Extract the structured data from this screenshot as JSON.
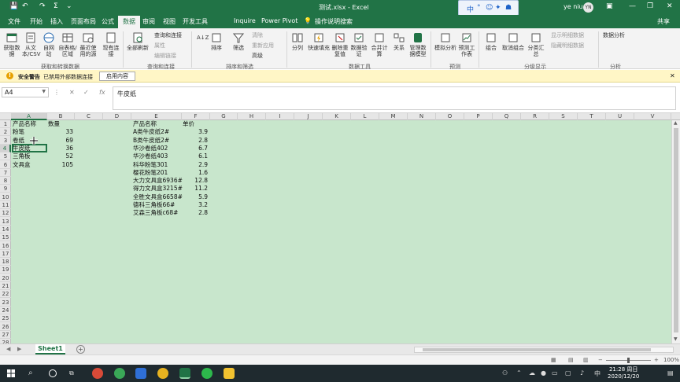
{
  "app": {
    "title": "测试.xlsx - Excel",
    "user": "ye niu",
    "user_initials": "YN",
    "share_label": "共享",
    "brand_color": "#217346"
  },
  "ime": {
    "chars": [
      "中",
      "°",
      "☺",
      "✦",
      "☗"
    ]
  },
  "tabs": [
    {
      "label": "文件"
    },
    {
      "label": "开始"
    },
    {
      "label": "插入"
    },
    {
      "label": "页面布局"
    },
    {
      "label": "公式"
    },
    {
      "label": "数据"
    },
    {
      "label": "审阅"
    },
    {
      "label": "视图"
    },
    {
      "label": "开发工具"
    },
    {
      "label": "Inquire"
    },
    {
      "label": "Power Pivot"
    },
    {
      "label": "操作说明搜索"
    }
  ],
  "ribbon": {
    "get_data": "获取数据",
    "from_csv": "从文本/CSV",
    "from_web": "自网站",
    "from_table": "自表格/区域",
    "recent_sources": "最近使用的源",
    "existing_conn": "现有连接",
    "group_get_transform": "获取和转换数据",
    "refresh_all": "全部刷新",
    "queries_conn": "查询和连接",
    "properties": "属性",
    "edit_links": "编辑链接",
    "group_queries": "查询和连接",
    "sort_az": "A↓Z",
    "sort": "排序",
    "filter": "筛选",
    "clear": "清除",
    "reapply": "重新应用",
    "advanced": "高级",
    "group_sort_filter": "排序和筛选",
    "text_to_col": "分列",
    "flash_fill": "快速填充",
    "remove_dup": "删除重复值",
    "data_validation": "数据验证",
    "consolidate": "合并计算",
    "relationships": "关系",
    "manage_model": "管理数据模型",
    "group_data_tools": "数据工具",
    "what_if": "模拟分析",
    "forecast_sheet": "预测工作表",
    "group_forecast": "预测",
    "group": "组合",
    "ungroup": "取消组合",
    "subtotal": "分类汇总",
    "show_detail": "显示明细数据",
    "hide_detail": "隐藏明细数据",
    "group_outline": "分级显示",
    "data_analysis": "数据分析",
    "group_analysis": "分析"
  },
  "security": {
    "title": "安全警告",
    "message": "已禁用外部数据连接",
    "button": "启用内容"
  },
  "formula": {
    "name_box": "A4",
    "value": "牛皮纸",
    "fx": "fx"
  },
  "grid": {
    "columns": [
      "A",
      "B",
      "C",
      "D",
      "E",
      "F",
      "G",
      "H",
      "I",
      "J",
      "K",
      "L",
      "M",
      "N",
      "O",
      "P",
      "Q",
      "R",
      "S",
      "T",
      "U",
      "V"
    ],
    "rows": [
      "1",
      "2",
      "3",
      "4",
      "5",
      "6",
      "7",
      "8",
      "9",
      "10",
      "11",
      "12",
      "13",
      "14",
      "15",
      "16",
      "17",
      "18",
      "19",
      "20",
      "21",
      "22",
      "23",
      "24",
      "25",
      "26",
      "27",
      "28"
    ],
    "table1_headers": [
      "产品名称",
      "数量"
    ],
    "table1": [
      {
        "name": "粉笔",
        "qty": "33"
      },
      {
        "name": "卷纸",
        "qty": "69"
      },
      {
        "name": "牛皮纸",
        "qty": "36"
      },
      {
        "name": "三角板",
        "qty": "52"
      },
      {
        "name": "文具盒",
        "qty": "105"
      }
    ],
    "table2_headers": [
      "产品名称",
      "单价"
    ],
    "table2": [
      {
        "name": "A类牛皮纸2#",
        "price": "3.9"
      },
      {
        "name": "B类牛皮纸2#",
        "price": "2.8"
      },
      {
        "name": "华沙卷纸402",
        "price": "6.7"
      },
      {
        "name": "华沙卷纸403",
        "price": "6.1"
      },
      {
        "name": "科华粉笔301",
        "price": "2.9"
      },
      {
        "name": "樱花粉笔201",
        "price": "1.6"
      },
      {
        "name": "大力文具盒6936#",
        "price": "12.8"
      },
      {
        "name": "得力文具盒3215#",
        "price": "11.2"
      },
      {
        "name": "全胜文具盒6658#",
        "price": "5.9"
      },
      {
        "name": "德科三角板66#",
        "price": "3.2"
      },
      {
        "name": "艾森三角板c68#",
        "price": "2.8"
      }
    ]
  },
  "sheets": [
    {
      "name": "Sheet1"
    }
  ],
  "status": {
    "zoom": "100%"
  },
  "taskbar": {
    "time": "21:28 周日",
    "date": "2020/12/20"
  }
}
